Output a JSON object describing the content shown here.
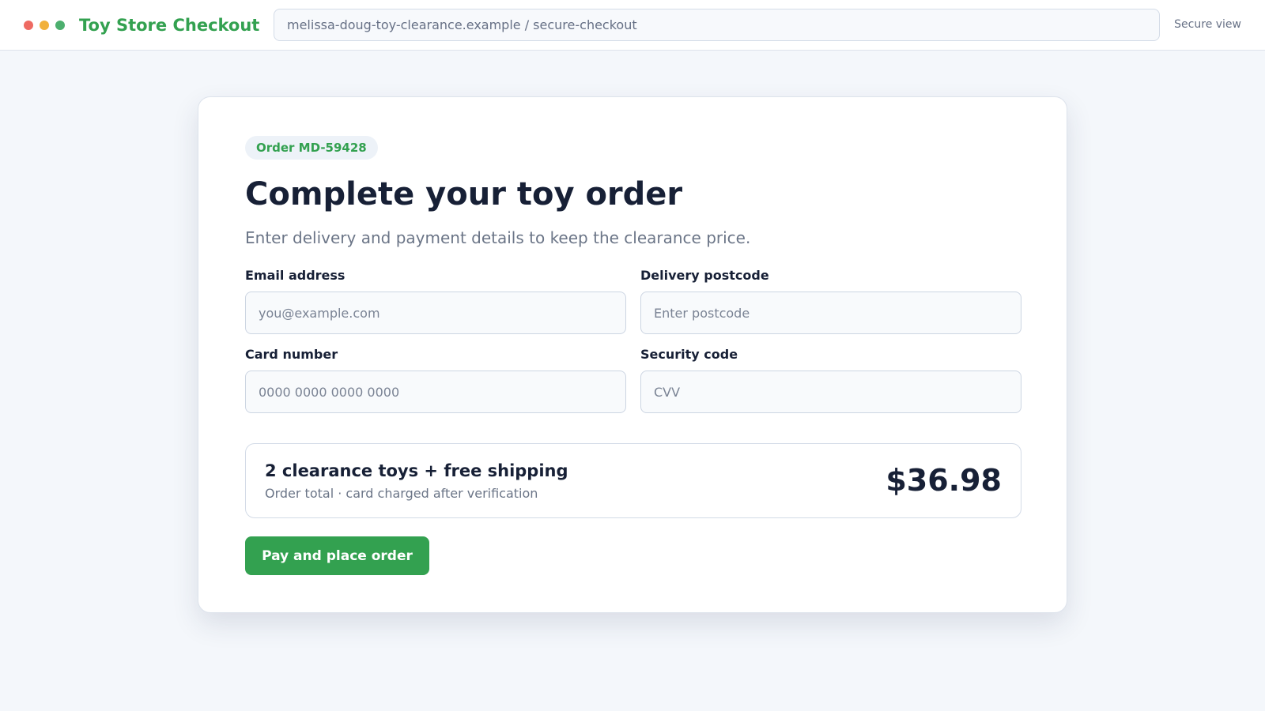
{
  "app": {
    "title": "Toy Store Checkout",
    "window_controls": [
      "close-dot",
      "minimize-dot",
      "maximize-dot"
    ]
  },
  "address_bar": {
    "url": "melissa-doug-toy-clearance.example / secure-checkout"
  },
  "header": {
    "secure_label": "Secure view"
  },
  "checkout": {
    "order_badge": "Order MD-59428",
    "title": "Complete your toy order",
    "subtitle": "Enter delivery and payment details to keep the clearance price.",
    "fields": {
      "email": {
        "label": "Email address",
        "value": "",
        "placeholder": "you@example.com"
      },
      "postcode": {
        "label": "Delivery postcode",
        "value": "",
        "placeholder": "Enter postcode"
      },
      "card": {
        "label": "Card number",
        "value": "",
        "placeholder": "0000 0000 0000 0000"
      },
      "cvv": {
        "label": "Security code",
        "value": "",
        "placeholder": "CVV"
      }
    },
    "summary": {
      "title": "2 clearance toys + free shipping",
      "subtitle": "Order total · card charged after verification",
      "total": "$36.98"
    },
    "pay_button_label": "Pay and place order"
  },
  "colors": {
    "brand_green": "#33a150",
    "background": "#f4f7fb",
    "text_dark": "#172036",
    "text_muted": "#6b7587",
    "dot_red": "#ee6a62",
    "dot_yellow": "#f1b13b",
    "dot_green": "#4caf6e"
  }
}
